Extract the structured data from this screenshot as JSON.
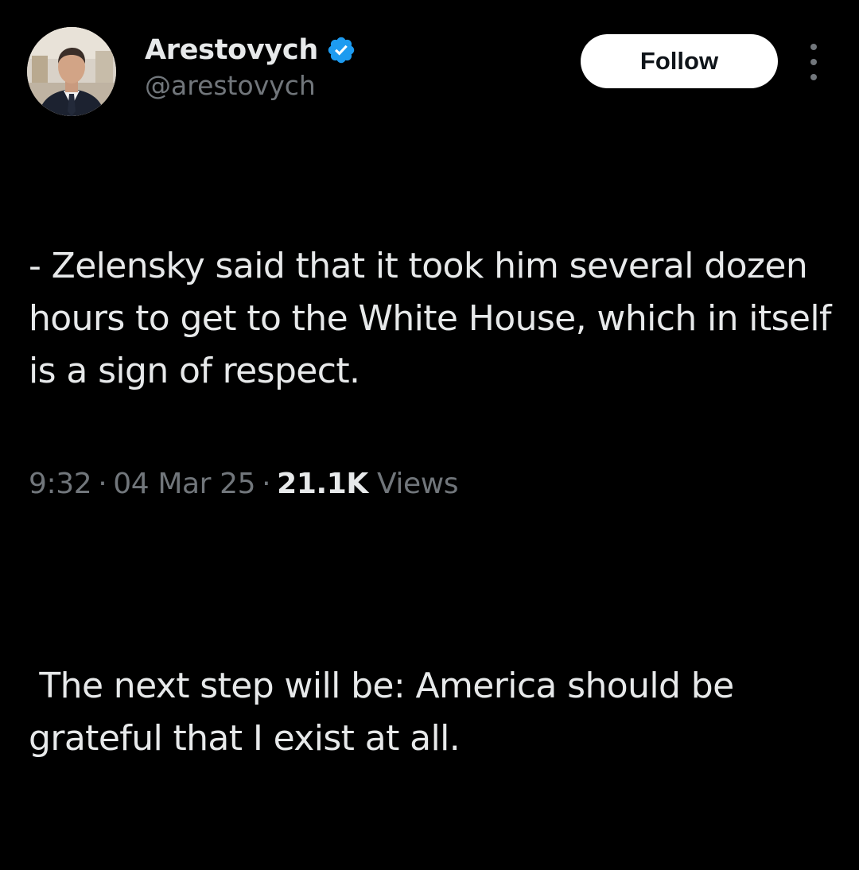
{
  "author": {
    "display_name": "Arestovych",
    "handle": "@arestovych",
    "verified_icon": "verified-badge-icon",
    "verified_color": "#1d9bf0"
  },
  "actions": {
    "follow_label": "Follow",
    "more_icon": "more-vertical-icon"
  },
  "tweet": {
    "paragraphs": [
      "- Zelensky said that it took him several dozen hours to get to the White House, which in itself is a sign of respect.",
      " The next step will be: America should be grateful that I exist at all."
    ]
  },
  "meta": {
    "time": "9:32",
    "separator": "·",
    "date": "04 Mar 25",
    "views_count": "21.1K",
    "views_label": "Views"
  },
  "colors": {
    "background": "#000000",
    "text_primary": "#e7e9ea",
    "text_secondary": "#71767b",
    "button_bg": "#ffffff",
    "button_text": "#0f1419"
  }
}
